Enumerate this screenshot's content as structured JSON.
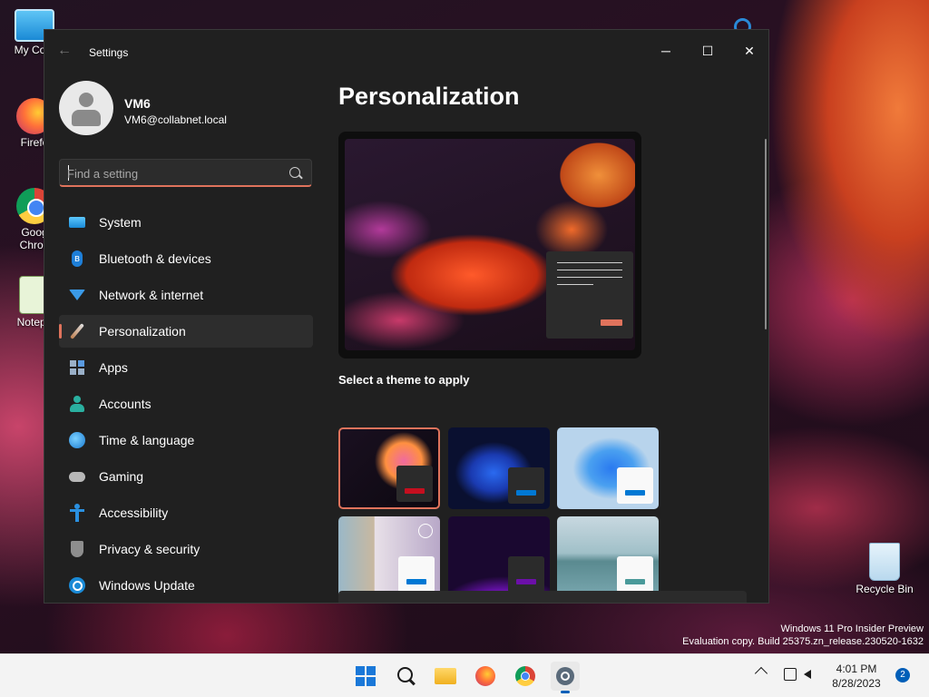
{
  "desktop": {
    "icons": [
      {
        "label": "My Com",
        "icon": "computer-icon"
      },
      {
        "label": "Firefo",
        "icon": "firefox-icon"
      },
      {
        "label": "Goog Chron",
        "icon": "chrome-icon"
      },
      {
        "label": "Notepa",
        "icon": "notepad-icon"
      }
    ],
    "recycle_bin": "Recycle Bin",
    "watermark_line1": "Windows 11 Pro Insider Preview",
    "watermark_line2": "Evaluation copy. Build 25375.zn_release.230520-1632"
  },
  "window": {
    "title": "Settings",
    "controls": {
      "minimize": "─",
      "maximize": "☐",
      "close": "✕"
    }
  },
  "user": {
    "name": "VM6",
    "email": "VM6@collabnet.local"
  },
  "search": {
    "placeholder": "Find a setting"
  },
  "nav": [
    {
      "label": "System",
      "icon": "system-icon"
    },
    {
      "label": "Bluetooth & devices",
      "icon": "bluetooth-icon"
    },
    {
      "label": "Network & internet",
      "icon": "wifi-icon"
    },
    {
      "label": "Personalization",
      "icon": "paintbrush-icon",
      "selected": true
    },
    {
      "label": "Apps",
      "icon": "apps-icon"
    },
    {
      "label": "Accounts",
      "icon": "accounts-icon"
    },
    {
      "label": "Time & language",
      "icon": "globe-clock-icon"
    },
    {
      "label": "Gaming",
      "icon": "gamepad-icon"
    },
    {
      "label": "Accessibility",
      "icon": "accessibility-icon"
    },
    {
      "label": "Privacy & security",
      "icon": "shield-icon"
    },
    {
      "label": "Windows Update",
      "icon": "update-icon"
    }
  ],
  "main": {
    "title": "Personalization",
    "themes_label": "Select a theme to apply",
    "themes": [
      {
        "name": "current-theme",
        "accent": "#c50f1f",
        "selected": true
      },
      {
        "name": "windows-dark",
        "accent": "#0078d4"
      },
      {
        "name": "windows-light",
        "accent": "#0078d4"
      },
      {
        "name": "windows-spotlight",
        "accent": "#0078d4"
      },
      {
        "name": "glow",
        "accent": "#6b0fa8"
      },
      {
        "name": "captured-motion",
        "accent": "#4a9a9a"
      }
    ]
  },
  "taskbar": {
    "apps": [
      "start-icon",
      "search-icon",
      "file-explorer-icon",
      "firefox-icon",
      "chrome-icon",
      "settings-icon"
    ],
    "time": "4:01 PM",
    "date": "8/28/2023",
    "notification_count": "2"
  },
  "colors": {
    "accent": "#e0735c",
    "window_bg": "#202020",
    "taskbar_bg": "#f3f3f3"
  }
}
